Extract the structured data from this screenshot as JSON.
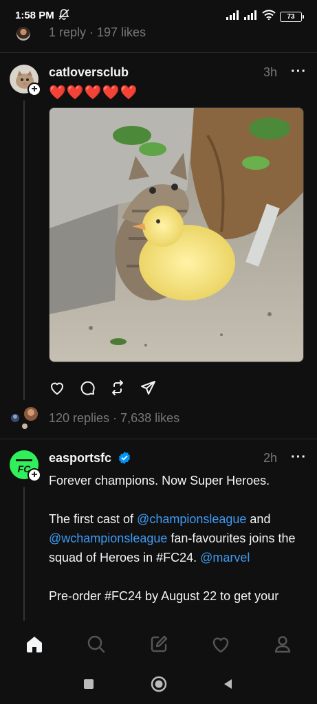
{
  "status_bar": {
    "time": "1:58 PM",
    "battery": "73",
    "icons": [
      "mute-icon",
      "signal-icon",
      "signal-icon",
      "wifi-icon",
      "battery-icon"
    ]
  },
  "previous_post": {
    "stats": "1 reply · 197 likes"
  },
  "post1": {
    "username": "catloversclub",
    "time": "3h",
    "more": "···",
    "text": "❤️❤️❤️❤️❤️",
    "image_description_icon": "kitten-duckling-photo",
    "stats": "120 replies · 7,638 likes"
  },
  "post2": {
    "username": "easportsfc",
    "time": "2h",
    "more": "···",
    "verified_color": "#0095f6",
    "line1": "Forever champions. Now Super Heroes.",
    "para2_a": "The first cast of ",
    "para2_mention1": "@championsleague",
    "para2_b": " and ",
    "para2_mention2": "@wchampionsleague",
    "para2_c": " fan-favourites joins the squad of Heroes in #FC24. ",
    "para2_mention3": "@marvel",
    "para3": "Pre-order #FC24 by August 22 to get your"
  },
  "tab_bar": {
    "tabs": [
      "home-icon",
      "search-icon",
      "compose-icon",
      "activity-heart-icon",
      "profile-icon"
    ]
  },
  "colors": {
    "background": "#101010",
    "mention": "#3d9bf4",
    "ea_green": "#2ff05a",
    "heart_red": "#e8213a"
  }
}
